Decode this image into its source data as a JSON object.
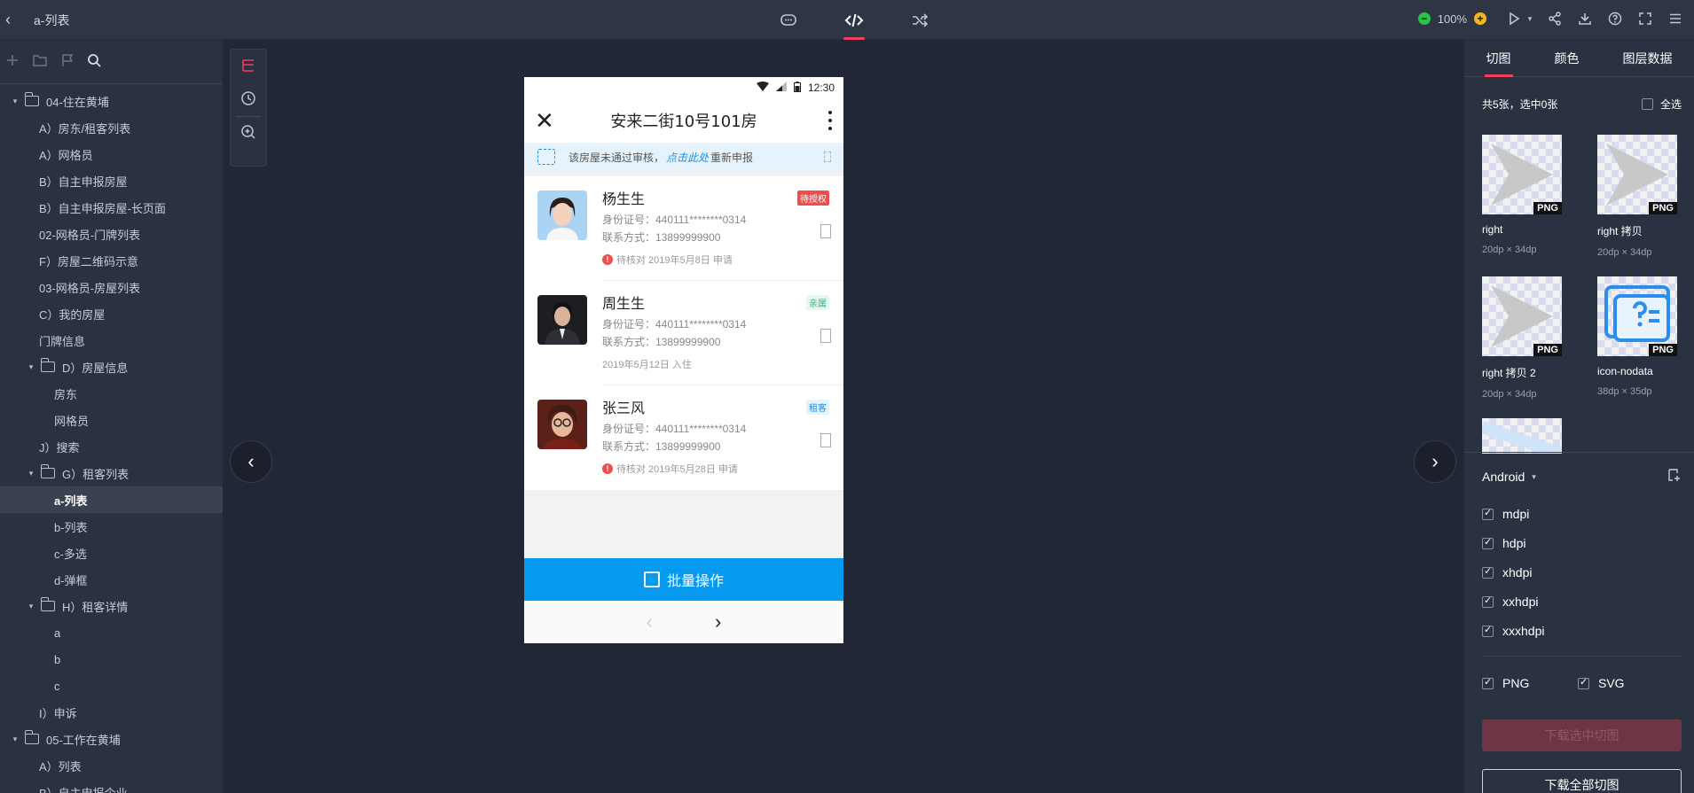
{
  "header": {
    "back_icon": "chevron-left-icon",
    "title": "a-列表",
    "zoom": "100%"
  },
  "left": {
    "tree": [
      {
        "label": "04-住在黄埔",
        "level": 0,
        "folder": true,
        "expanded": true
      },
      {
        "label": "A）房东/租客列表",
        "level": 1
      },
      {
        "label": "A）网格员",
        "level": 1
      },
      {
        "label": "B）自主申报房屋",
        "level": 1
      },
      {
        "label": "B）自主申报房屋-长页面",
        "level": 1
      },
      {
        "label": "02-网格员-门牌列表",
        "level": 1
      },
      {
        "label": "F）房屋二维码示意",
        "level": 1
      },
      {
        "label": "03-网格员-房屋列表",
        "level": 1
      },
      {
        "label": "C）我的房屋",
        "level": 1
      },
      {
        "label": "门牌信息",
        "level": 1
      },
      {
        "label": "D）房屋信息",
        "level": 1,
        "folder": true,
        "expanded": true
      },
      {
        "label": "房东",
        "level": 2
      },
      {
        "label": "网格员",
        "level": 2
      },
      {
        "label": "J）搜索",
        "level": 1
      },
      {
        "label": "G）租客列表",
        "level": 1,
        "folder": true,
        "expanded": true
      },
      {
        "label": "a-列表",
        "level": 2,
        "selected": true
      },
      {
        "label": "b-列表",
        "level": 2
      },
      {
        "label": "c-多选",
        "level": 2
      },
      {
        "label": "d-弹框",
        "level": 2
      },
      {
        "label": "H）租客详情",
        "level": 1,
        "folder": true,
        "expanded": true
      },
      {
        "label": "a",
        "level": 2
      },
      {
        "label": "b",
        "level": 2
      },
      {
        "label": "c",
        "level": 2
      },
      {
        "label": "I）申诉",
        "level": 1
      },
      {
        "label": "05-工作在黄埔",
        "level": 0,
        "folder": true,
        "expanded": true
      },
      {
        "label": "A）列表",
        "level": 1
      },
      {
        "label": "B）自主申报企业",
        "level": 1
      }
    ]
  },
  "phone": {
    "time": "12:30",
    "title": "安来二街10号101房",
    "notice": {
      "before": "该房屋未通过审核，",
      "link": "点击此处",
      "after": "重新申报"
    },
    "cards": [
      {
        "name": "杨生生",
        "id": "身份证号：440111********0314",
        "phone": "联系方式：13899999900",
        "status": "待核对  2019年5月8日  申请",
        "warn": true,
        "tag": "待授权",
        "tag_color": "red"
      },
      {
        "name": "周生生",
        "id": "身份证号：440111********0314",
        "phone": "联系方式：13899999900",
        "status": "2019年5月12日  入住",
        "warn": false,
        "tag": "亲属",
        "tag_color": "green"
      },
      {
        "name": "张三风",
        "id": "身份证号：440111********0314",
        "phone": "联系方式：13899999900",
        "status": "待核对  2019年5月28日  申请",
        "warn": true,
        "tag": "租客",
        "tag_color": "blue"
      }
    ],
    "batch_label": "批量操作"
  },
  "right": {
    "tabs": [
      "切图",
      "颜色",
      "图层数据"
    ],
    "summary": "共5张，选中0张",
    "select_all": "全选",
    "slices": [
      {
        "name": "right",
        "size": "20dp × 34dp",
        "badge": "PNG"
      },
      {
        "name": "right 拷贝",
        "size": "20dp × 34dp",
        "badge": "PNG"
      },
      {
        "name": "right 拷贝 2",
        "size": "20dp × 34dp",
        "badge": "PNG"
      },
      {
        "name": "icon-nodata",
        "size": "38dp × 35dp",
        "badge": "PNG"
      }
    ],
    "platform": "Android",
    "dpis": [
      "mdpi",
      "hdpi",
      "xhdpi",
      "xxhdpi",
      "xxxhdpi"
    ],
    "formats": [
      "PNG",
      "SVG"
    ],
    "download_selected": "下载选中切图",
    "download_all": "下载全部切图"
  }
}
